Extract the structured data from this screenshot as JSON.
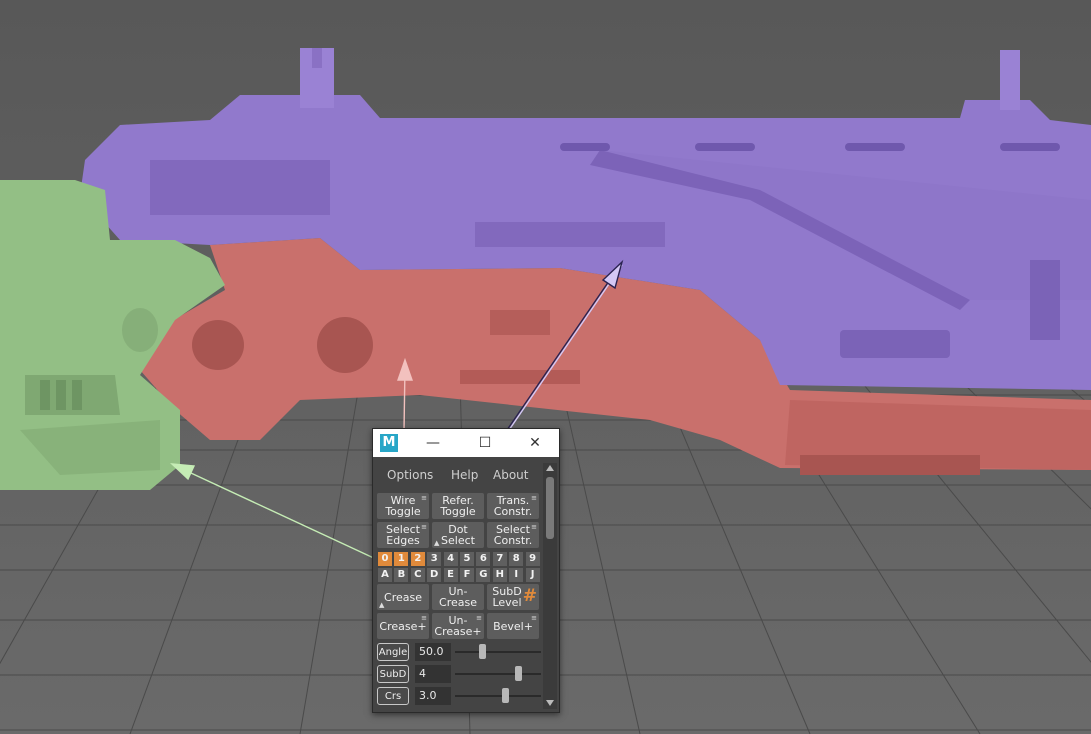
{
  "window": {
    "app_icon": "M",
    "minimize_icon": "—",
    "maximize_icon": "☐",
    "close_icon": "✕"
  },
  "menu": {
    "options": "Options",
    "help": "Help",
    "about": "About"
  },
  "buttons": {
    "wire_toggle": "Wire\nToggle",
    "refer_toggle": "Refer.\nToggle",
    "trans_constr": "Trans.\nConstr.",
    "select_edges": "Select\nEdges",
    "dot_select": "Dot\nSelect",
    "select_constr": "Select\nConstr.",
    "crease": "Crease",
    "uncrease": "Un-\nCrease",
    "subd_level": "SubD\nLevel",
    "subd_hash": "#",
    "crease_plus": "Crease+",
    "uncrease_plus": "Un-\nCrease+",
    "bevel_plus": "Bevel+"
  },
  "number_keys": [
    "0",
    "1",
    "2",
    "3",
    "4",
    "5",
    "6",
    "7",
    "8",
    "9"
  ],
  "active_number_keys": [
    "0",
    "1",
    "2"
  ],
  "letter_keys": [
    "A",
    "B",
    "C",
    "D",
    "E",
    "F",
    "G",
    "H",
    "I",
    "J"
  ],
  "params": {
    "angle": {
      "label": "Angle",
      "value": "50.0",
      "slider_fraction": 0.3
    },
    "subd": {
      "label": "SubD",
      "value": "4",
      "slider_fraction": 0.76
    },
    "crs": {
      "label": "Crs",
      "value": "3.0",
      "slider_fraction": 0.6
    }
  },
  "colors": {
    "purple_part": "#9179cc",
    "red_part": "#c9706c",
    "green_part": "#93bf85",
    "accent": "#e08a3b",
    "viewport_bg": "#5e5e5e"
  }
}
